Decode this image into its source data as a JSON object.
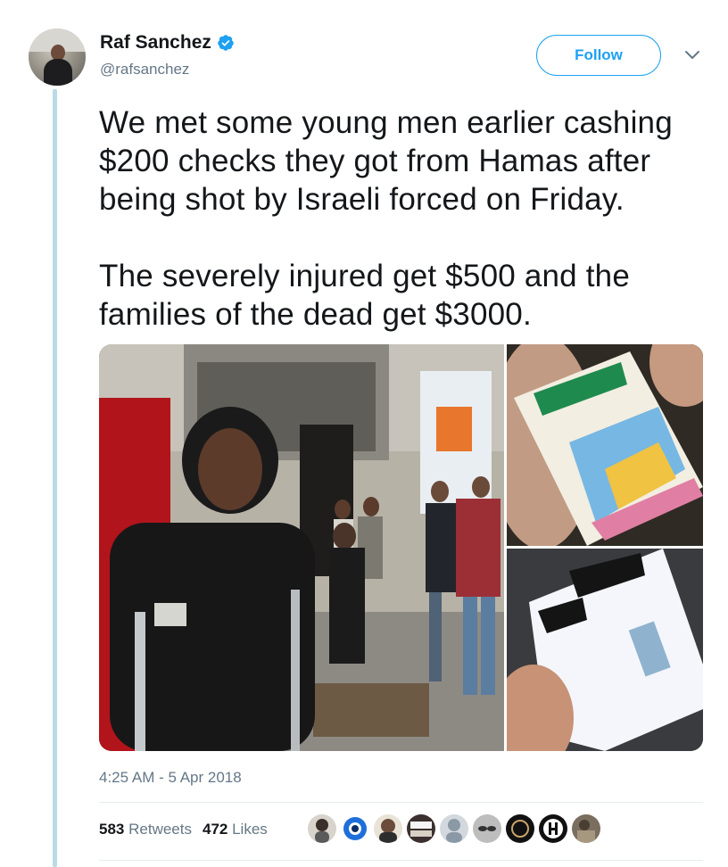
{
  "author": {
    "name": "Raf Sanchez",
    "handle": "@rafsanchez",
    "verified": true
  },
  "follow_label": "Follow",
  "tweet": {
    "text": "We met some young men earlier cashing $200 checks they got from Hamas after being shot by Israeli forced on Friday.\n\nThe severely injured get $500 and the families of the dead get $3000."
  },
  "timestamp": "4:25 AM - 5 Apr 2018",
  "stats": {
    "retweets_count": "583",
    "retweets_label": "Retweets",
    "likes_count": "472",
    "likes_label": "Likes"
  },
  "colors": {
    "accent": "#1da1f2",
    "secondary_text": "#657786",
    "thread_line": "#b8dbe6"
  },
  "icons": {
    "verified": "verified-badge-icon",
    "menu": "chevron-down-icon"
  }
}
